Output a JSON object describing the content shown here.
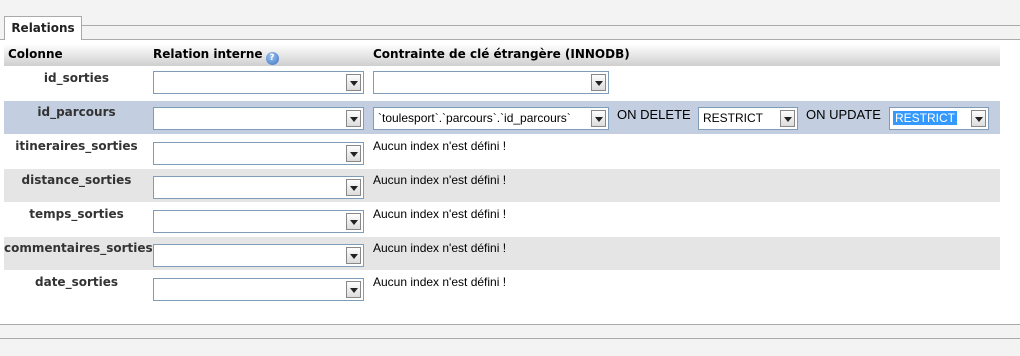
{
  "tab": {
    "label": "Relations"
  },
  "header": {
    "col1": "Colonne",
    "col2": "Relation interne",
    "col3": "Contrainte de clé étrangère (INNODB)"
  },
  "rows": [
    {
      "name": "id_sorties",
      "internal": "",
      "fk": ""
    },
    {
      "name": "id_parcours",
      "internal": "",
      "fk": "`toulesport`.`parcours`.`id_parcours`",
      "on_delete_label": "ON DELETE",
      "on_delete": "RESTRICT",
      "on_update_label": "ON UPDATE",
      "on_update": "RESTRICT"
    },
    {
      "name": "itineraires_sorties",
      "internal": "",
      "note": "Aucun index n'est défini !"
    },
    {
      "name": "distance_sorties",
      "internal": "",
      "note": "Aucun index n'est défini !"
    },
    {
      "name": "temps_sorties",
      "internal": "",
      "note": "Aucun index n'est défini !"
    },
    {
      "name": "commentaires_sorties",
      "internal": "",
      "note": "Aucun index n'est défini !"
    },
    {
      "name": "date_sorties",
      "internal": "",
      "note": "Aucun index n'est défini !"
    }
  ],
  "icons": {
    "help": "help-icon"
  }
}
